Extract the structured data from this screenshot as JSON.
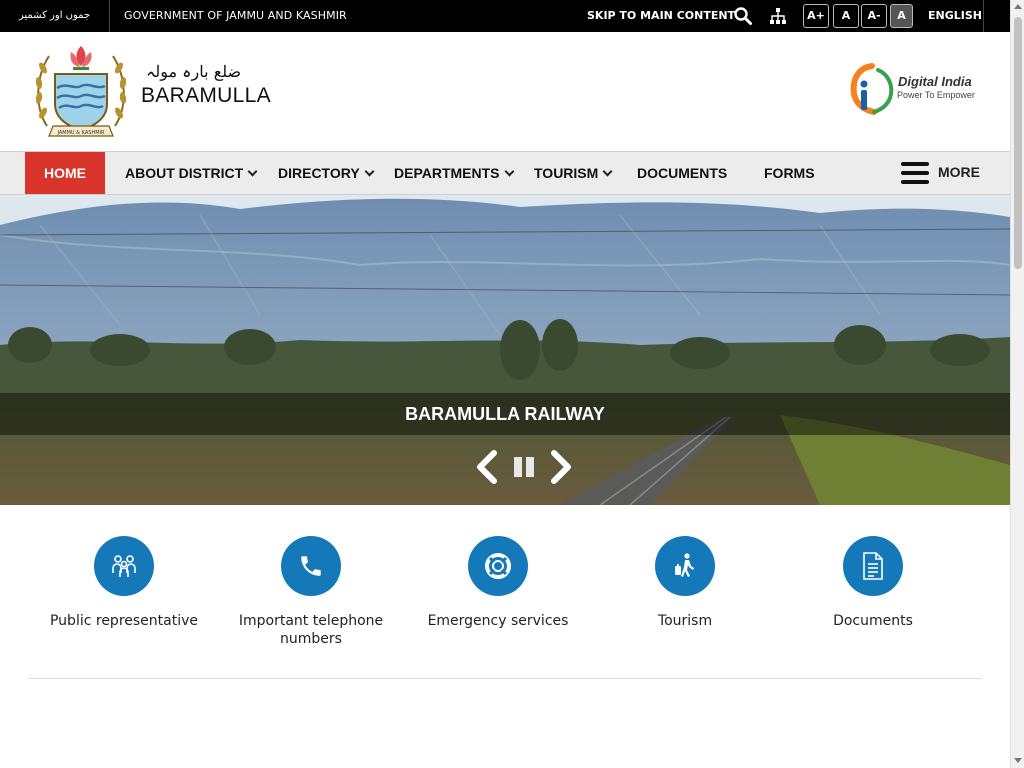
{
  "topbar": {
    "urdu_state": "جموں اور کشمیر",
    "government": "GOVERNMENT OF JAMMU AND KASHMIR",
    "skip": "SKIP TO MAIN CONTENT",
    "font_increase": "A+",
    "font_normal": "A",
    "font_decrease": "A-",
    "contrast": "A",
    "language": "ENGLISH",
    "icons": [
      "search-icon",
      "sitemap-icon"
    ]
  },
  "header": {
    "urdu_name": "ضلع بارہ مولہ",
    "district_name": "BARAMULLA",
    "emblem_text": "JAMMU & KASHMIR",
    "digital_india_title": "Digital India",
    "digital_india_tagline": "Power To Empower"
  },
  "nav": {
    "items": [
      {
        "label": "HOME",
        "active": true,
        "dropdown": false
      },
      {
        "label": "ABOUT DISTRICT",
        "dropdown": true
      },
      {
        "label": "DIRECTORY",
        "dropdown": true
      },
      {
        "label": "DEPARTMENTS",
        "dropdown": true
      },
      {
        "label": "TOURISM",
        "dropdown": true
      },
      {
        "label": "DOCUMENTS",
        "dropdown": false
      },
      {
        "label": "FORMS",
        "dropdown": false
      }
    ],
    "more_label": "MORE"
  },
  "slider": {
    "caption": "BARAMULLA RAILWAY",
    "controls": [
      "previous-icon",
      "pause-icon",
      "next-icon"
    ]
  },
  "quick_links": [
    {
      "label": "Public representative",
      "icon": "people-icon"
    },
    {
      "label": "Important telephone numbers",
      "icon": "phone-icon"
    },
    {
      "label": "Emergency services",
      "icon": "lifebuoy-icon"
    },
    {
      "label": "Tourism",
      "icon": "traveler-icon"
    },
    {
      "label": "Documents",
      "icon": "document-icon"
    }
  ],
  "colors": {
    "accent_red": "#d9342b",
    "icon_blue": "#1579b9",
    "topbar_bg": "#000000",
    "nav_bg": "#ececec"
  }
}
